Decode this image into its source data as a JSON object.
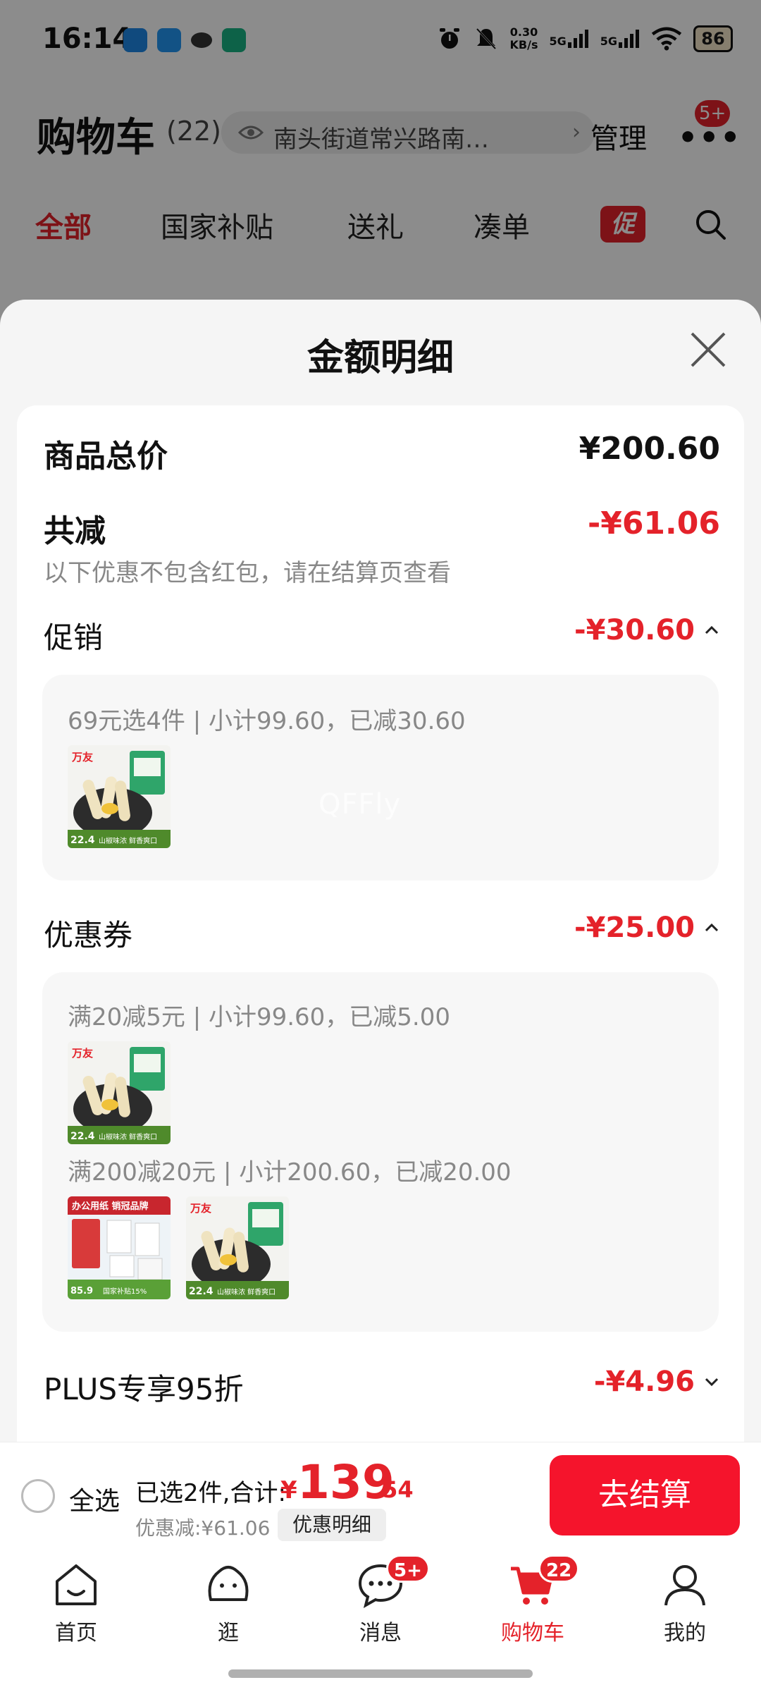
{
  "status_bar": {
    "time": "16:14",
    "net_speed_value": "0.30",
    "net_speed_unit": "KB/s",
    "signal1": "5G",
    "signal2": "5G",
    "battery": "86"
  },
  "header": {
    "title": "购物车",
    "count": "(22)",
    "address": "南头街道常兴路南…",
    "manage": "管理",
    "more_badge": "5+"
  },
  "category_tabs": [
    "全部",
    "国家补贴",
    "送礼",
    "凑单"
  ],
  "promo_tab_label": "促",
  "sheet": {
    "title": "金额明细",
    "total_label": "商品总价",
    "total_value": "¥200.60",
    "reduce_label": "共减",
    "reduce_value": "-¥61.06",
    "note": "以下优惠不包含红包，请在结算页查看",
    "promo": {
      "label": "促销",
      "value": "-¥30.60",
      "line": "69元选4件 | 小计99.60，已减30.60"
    },
    "coupon": {
      "label": "优惠券",
      "value": "-¥25.00",
      "line1": "满20减5元 | 小计99.60，已减5.00",
      "line2": "满200减20元 | 小计200.60，已减20.00"
    },
    "plus": {
      "label": "PLUS专享95折",
      "value": "-¥4.96"
    },
    "watermark": "QFFly"
  },
  "product_thumbs": {
    "snack_brand": "万友",
    "snack_price": "22.4",
    "snack_tagline": "山椒味浓 鲜香爽口",
    "paper_title": "办公用纸 销冠品牌",
    "paper_price": "85.9",
    "paper_subsidy": "国家补贴15%"
  },
  "checkout": {
    "select_all": "全选",
    "selected_summary": "已选2件,合计:",
    "currency": "¥",
    "total_int": "139",
    "total_dec": ".54",
    "discount": "优惠减:¥61.06",
    "detail_button": "优惠明细",
    "checkout_button": "去结算"
  },
  "nav": {
    "items": [
      {
        "label": "首页"
      },
      {
        "label": "逛"
      },
      {
        "label": "消息",
        "badge": "5+"
      },
      {
        "label": "购物车",
        "badge": "22"
      },
      {
        "label": "我的"
      }
    ]
  },
  "colors": {
    "accent": "#e4222a",
    "checkout": "#f5142c"
  }
}
